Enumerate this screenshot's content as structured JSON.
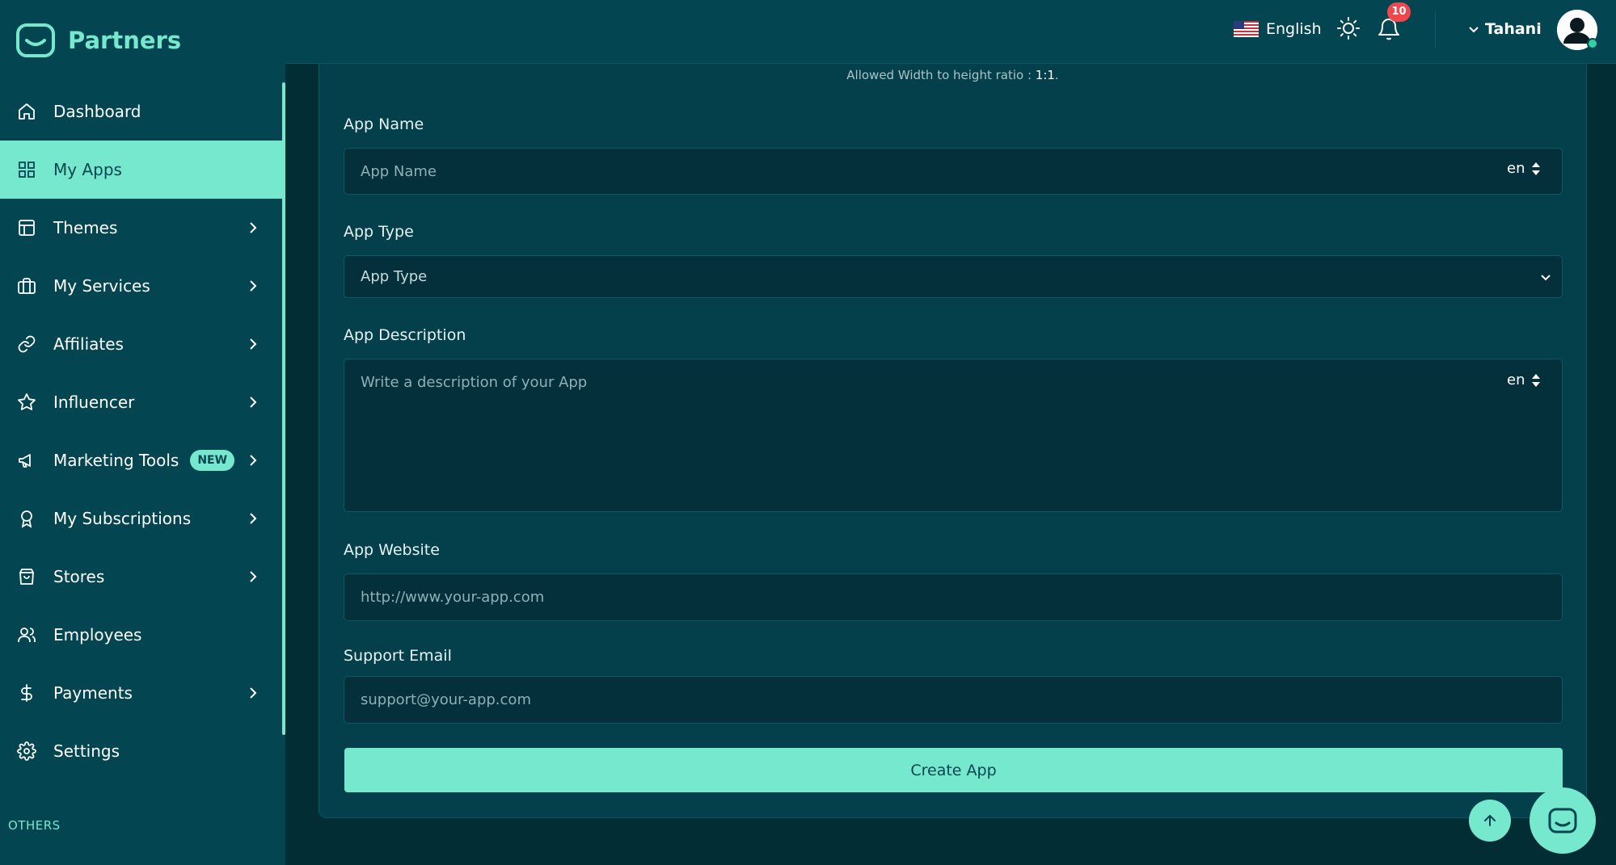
{
  "brand": {
    "name": "Partners",
    "logo_icon": "brand-logo-icon"
  },
  "sidebar": {
    "items": [
      {
        "label": "Dashboard",
        "icon": "home-icon",
        "has_submenu": false,
        "active": false
      },
      {
        "label": "My Apps",
        "icon": "grid-icon",
        "has_submenu": false,
        "active": true
      },
      {
        "label": "Themes",
        "icon": "layout-icon",
        "has_submenu": true,
        "active": false
      },
      {
        "label": "My Services",
        "icon": "briefcase-icon",
        "has_submenu": true,
        "active": false
      },
      {
        "label": "Affiliates",
        "icon": "link-icon",
        "has_submenu": true,
        "active": false
      },
      {
        "label": "Influencer",
        "icon": "star-icon",
        "has_submenu": true,
        "active": false
      },
      {
        "label": "Marketing Tools",
        "icon": "megaphone-icon",
        "has_submenu": true,
        "active": false,
        "badge": "NEW"
      },
      {
        "label": "My Subscriptions",
        "icon": "award-icon",
        "has_submenu": true,
        "active": false
      },
      {
        "label": "Stores",
        "icon": "shopping-bag-icon",
        "has_submenu": true,
        "active": false
      },
      {
        "label": "Employees",
        "icon": "users-icon",
        "has_submenu": false,
        "active": false
      },
      {
        "label": "Payments",
        "icon": "dollar-icon",
        "has_submenu": true,
        "active": false
      },
      {
        "label": "Settings",
        "icon": "gear-icon",
        "has_submenu": false,
        "active": false
      }
    ],
    "section_label": "OTHERS"
  },
  "header": {
    "language": "English",
    "notification_count": "10",
    "user_name": "Tahani"
  },
  "form": {
    "ratio_hint_prefix": "Allowed Width to height ratio : ",
    "ratio_value": "1:1",
    "ratio_suffix": ".",
    "app_name": {
      "label": "App Name",
      "placeholder": "App Name",
      "lang": "en"
    },
    "app_type": {
      "label": "App Type",
      "placeholder": "App Type"
    },
    "app_description": {
      "label": "App Description",
      "placeholder": "Write a description of your App",
      "lang": "en"
    },
    "app_website": {
      "label": "App Website",
      "placeholder": "http://www.your-app.com"
    },
    "support_email": {
      "label": "Support Email",
      "placeholder": "support@your-app.com"
    },
    "submit_label": "Create App"
  },
  "colors": {
    "accent": "#76e8cd",
    "sidebar_bg": "#044552",
    "page_bg": "#032d35",
    "notification": "#f0474f"
  }
}
